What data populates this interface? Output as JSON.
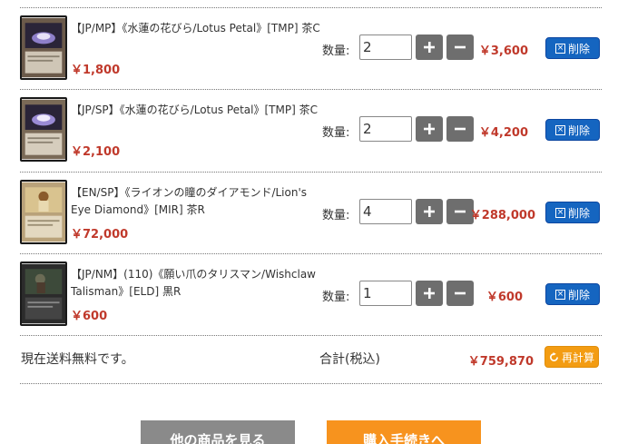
{
  "labels": {
    "qty": "数量:",
    "delete": "削除"
  },
  "items": [
    {
      "title": "【JP/MP】《水蓮の花びら/Lotus Petal》[TMP] 茶C",
      "unit_price": "￥1,800",
      "quantity": "2",
      "subtotal": "￥3,600"
    },
    {
      "title": "【JP/SP】《水蓮の花びら/Lotus Petal》[TMP] 茶C",
      "unit_price": "￥2,100",
      "quantity": "2",
      "subtotal": "￥4,200"
    },
    {
      "title": "【EN/SP】《ライオンの瞳のダイアモンド/Lion's Eye Diamond》[MIR] 茶R",
      "unit_price": "￥72,000",
      "quantity": "4",
      "subtotal": "￥288,000"
    },
    {
      "title": "【JP/NM】(110)《願い爪のタリスマン/Wishclaw Talisman》[ELD] 黒R",
      "unit_price": "￥600",
      "quantity": "1",
      "subtotal": "￥600"
    }
  ],
  "footer": {
    "shipping_note": "現在送料無料です。",
    "total_label": "合計(税込)",
    "total_value": "￥759,870",
    "recalc_label": "再計算"
  },
  "buttons": {
    "more_products": "他の商品を見る",
    "checkout": "購入手続きへ"
  },
  "colors": {
    "price": "#c0392b",
    "delete_button": "#1565c0",
    "recalc_button": "#f39c12",
    "stepper_button": "#6e6e6e",
    "more_button": "#8a8a8a",
    "checkout_button": "#f7931e"
  }
}
